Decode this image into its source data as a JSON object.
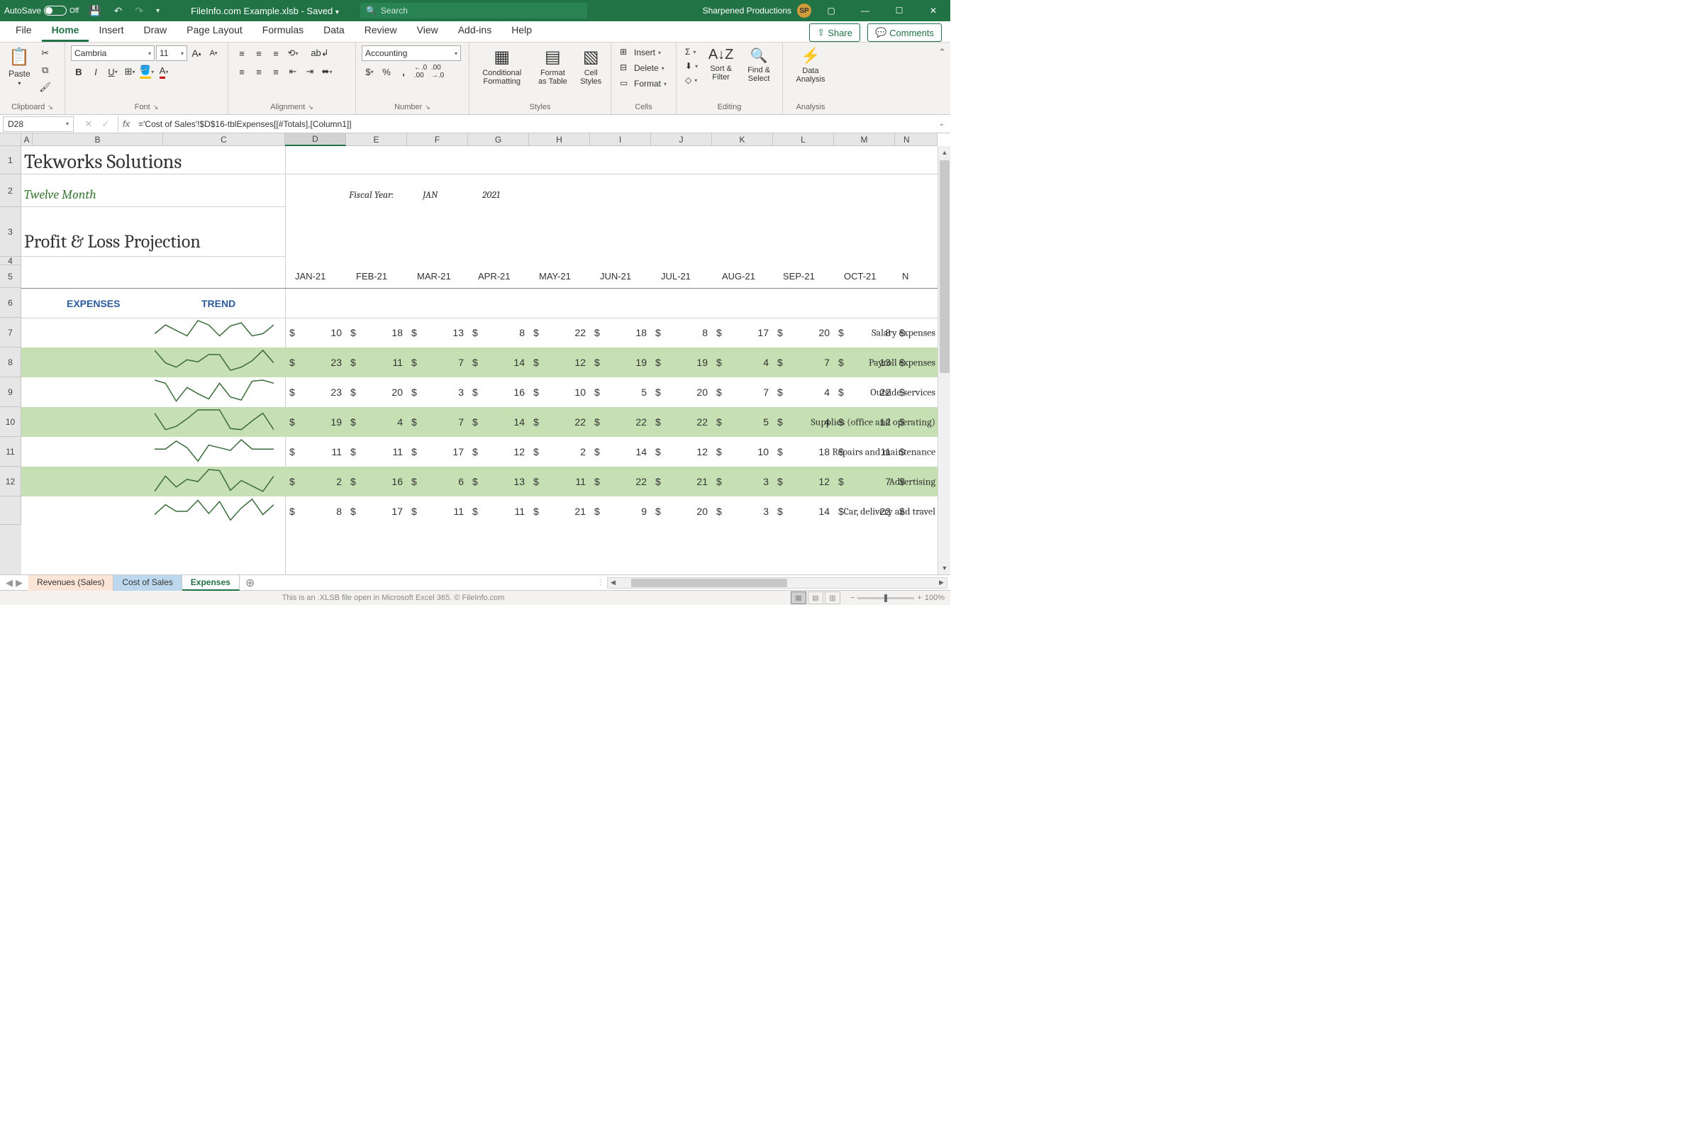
{
  "titlebar": {
    "autosave_label": "AutoSave",
    "autosave_state": "Off",
    "filename": "FileInfo.com Example.xlsb - Saved",
    "search_placeholder": "Search",
    "account_name": "Sharpened Productions",
    "account_initials": "SP"
  },
  "ribbon_tabs": [
    "File",
    "Home",
    "Insert",
    "Draw",
    "Page Layout",
    "Formulas",
    "Data",
    "Review",
    "View",
    "Add-ins",
    "Help"
  ],
  "active_tab": "Home",
  "share_label": "Share",
  "comments_label": "Comments",
  "ribbon": {
    "clipboard_label": "Clipboard",
    "paste_label": "Paste",
    "font_label": "Font",
    "font_name": "Cambria",
    "font_size": "11",
    "alignment_label": "Alignment",
    "number_label": "Number",
    "number_format": "Accounting",
    "styles_label": "Styles",
    "cond_fmt": "Conditional Formatting",
    "fmt_table": "Format as Table",
    "cell_styles": "Cell Styles",
    "cells_label": "Cells",
    "insert": "Insert",
    "delete": "Delete",
    "format": "Format",
    "editing_label": "Editing",
    "sort_filter": "Sort & Filter",
    "find_select": "Find & Select",
    "analysis_label": "Analysis",
    "data_analysis": "Data Analysis"
  },
  "namebox": "D28",
  "formula": "='Cost of Sales'!$D$16-tblExpenses[[#Totals],[Column1]]",
  "columns": [
    "A",
    "B",
    "C",
    "D",
    "E",
    "F",
    "G",
    "H",
    "I",
    "J",
    "K",
    "L",
    "M"
  ],
  "selected_col": "D",
  "row_numbers": [
    1,
    2,
    3,
    4,
    5,
    6,
    7,
    8,
    9,
    10,
    11,
    12
  ],
  "sheet": {
    "company": "Tekworks Solutions",
    "subtitle": "Twelve Month",
    "section": "Profit & Loss Projection",
    "fy_label": "Fiscal Year:",
    "fy_month": "JAN",
    "fy_year": "2021",
    "hdr_expenses": "EXPENSES",
    "hdr_trend": "TREND",
    "months": [
      "JAN-21",
      "FEB-21",
      "MAR-21",
      "APR-21",
      "MAY-21",
      "JUN-21",
      "JUL-21",
      "AUG-21",
      "SEP-21",
      "OCT-21"
    ],
    "rows": [
      {
        "label": "Salary expenses",
        "striped": false,
        "values": [
          10,
          18,
          13,
          8,
          22,
          18,
          8,
          17,
          20,
          8
        ]
      },
      {
        "label": "Payroll expenses",
        "striped": true,
        "values": [
          23,
          11,
          7,
          14,
          12,
          19,
          19,
          4,
          7,
          13
        ]
      },
      {
        "label": "Outside services",
        "striped": false,
        "values": [
          23,
          20,
          3,
          16,
          10,
          5,
          20,
          7,
          4,
          22
        ]
      },
      {
        "label": "Supplies (office and operating)",
        "striped": true,
        "values": [
          19,
          4,
          7,
          14,
          22,
          22,
          22,
          5,
          4,
          12
        ]
      },
      {
        "label": "Repairs and maintenance",
        "striped": false,
        "values": [
          11,
          11,
          17,
          12,
          2,
          14,
          12,
          10,
          18,
          11
        ]
      },
      {
        "label": "Advertising",
        "striped": true,
        "values": [
          2,
          16,
          6,
          13,
          11,
          22,
          21,
          3,
          12,
          7
        ]
      },
      {
        "label": "Car, delivery and travel",
        "striped": false,
        "values": [
          8,
          17,
          11,
          11,
          21,
          9,
          20,
          3,
          14,
          22
        ]
      }
    ]
  },
  "sheet_tabs": {
    "tabs": [
      {
        "name": "Revenues (Sales)",
        "class": "rev"
      },
      {
        "name": "Cost of Sales",
        "class": "cos"
      },
      {
        "name": "Expenses",
        "class": "exp"
      }
    ]
  },
  "statusbar": {
    "text": "This is an .XLSB file open in Microsoft Excel 365. © FileInfo.com",
    "zoom": "100%"
  },
  "next_month_marker": "N"
}
